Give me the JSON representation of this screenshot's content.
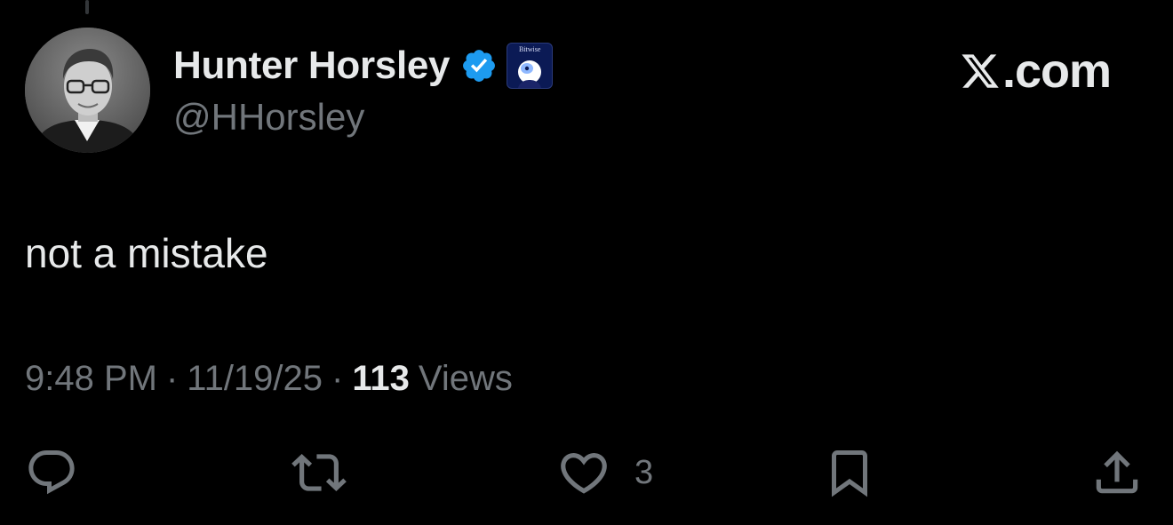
{
  "author": {
    "display_name": "Hunter Horsley",
    "handle": "@HHorsley",
    "affiliate_label": "Bitwise",
    "avatar_icon": "profile-photo",
    "verified_color": "#1d9bf0"
  },
  "watermark": {
    "text": ".com",
    "logo": "x-logo-icon"
  },
  "tweet": {
    "text": "not a mistake",
    "time": "9:48 PM",
    "date": "11/19/25",
    "separator": "·",
    "views_count": "113",
    "views_label": "Views"
  },
  "actions": {
    "reply": {
      "icon": "reply-icon"
    },
    "retweet": {
      "icon": "retweet-icon"
    },
    "like": {
      "icon": "heart-icon",
      "count": "3"
    },
    "bookmark": {
      "icon": "bookmark-icon"
    },
    "share": {
      "icon": "share-icon"
    }
  },
  "colors": {
    "background": "#000000",
    "primary_text": "#e7e9ea",
    "secondary_text": "#71767b"
  }
}
